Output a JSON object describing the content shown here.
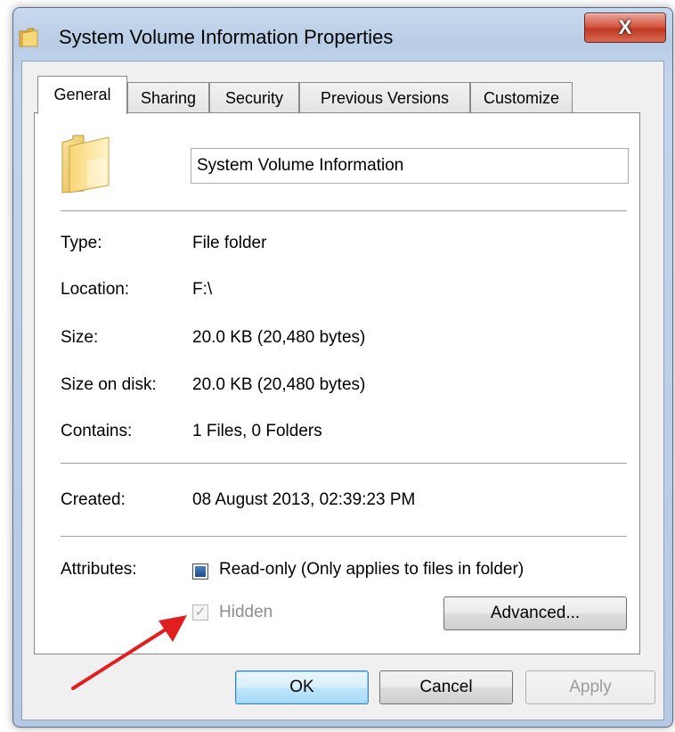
{
  "window": {
    "title": "System Volume Information Properties",
    "close_glyph": "X"
  },
  "tabs": [
    {
      "label": "General",
      "active": true
    },
    {
      "label": "Sharing",
      "active": false
    },
    {
      "label": "Security",
      "active": false
    },
    {
      "label": "Previous Versions",
      "active": false
    },
    {
      "label": "Customize",
      "active": false
    }
  ],
  "general": {
    "folder_name": "System Volume Information",
    "props": [
      {
        "label": "Type:",
        "value": "File folder"
      },
      {
        "label": "Location:",
        "value": "F:\\"
      },
      {
        "label": "Size:",
        "value": "20.0 KB (20,480 bytes)"
      },
      {
        "label": "Size on disk:",
        "value": "20.0 KB (20,480 bytes)"
      },
      {
        "label": "Contains:",
        "value": "1 Files, 0 Folders"
      }
    ],
    "created": {
      "label": "Created:",
      "value": "08 August 2013, 02:39:23 PM"
    },
    "attributes": {
      "label": "Attributes:",
      "readonly_label": "Read-only (Only applies to files in folder)",
      "readonly_state": "indeterminate",
      "hidden_label": "Hidden",
      "hidden_checked": true,
      "hidden_disabled": true,
      "advanced_label": "Advanced..."
    }
  },
  "buttons": {
    "ok": "OK",
    "cancel": "Cancel",
    "apply": "Apply"
  },
  "colors": {
    "annotation_arrow": "#e02020",
    "folder_yellow": "#f2c94c"
  },
  "icons": {
    "title": "folder-icon",
    "folder": "folder-icon",
    "annotation": "arrow-icon"
  }
}
